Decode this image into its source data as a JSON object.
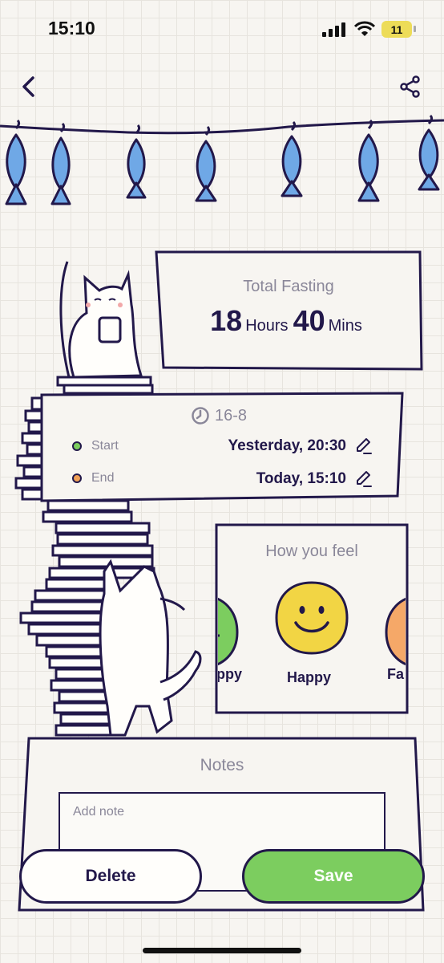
{
  "status_bar": {
    "time": "15:10",
    "battery": "11",
    "icons": [
      "signal-icon",
      "wifi-icon",
      "battery-icon"
    ]
  },
  "header": {
    "back_icon": "chevron-left-icon",
    "share_icon": "share-icon"
  },
  "total_fasting": {
    "label": "Total Fasting",
    "hours": "18",
    "hours_unit": "Hours",
    "minutes": "40",
    "minutes_unit": "Mins"
  },
  "plan": {
    "icon": "clock-icon",
    "name": "16-8",
    "start": {
      "label": "Start",
      "value": "Yesterday, 20:30",
      "dot_color": "#7ccd5f"
    },
    "end": {
      "label": "End",
      "value": "Today, 15:10",
      "dot_color": "#f0a056"
    }
  },
  "feel": {
    "title": "How you feel",
    "moods": [
      {
        "label": "ppy",
        "color": "#7ccd5f"
      },
      {
        "label": "Happy",
        "color": "#f2d544",
        "selected": true
      },
      {
        "label": "Fa",
        "color": "#f5a868"
      }
    ]
  },
  "notes": {
    "title": "Notes",
    "placeholder": "Add note",
    "value": ""
  },
  "actions": {
    "delete_label": "Delete",
    "save_label": "Save"
  },
  "colors": {
    "ink": "#22184a",
    "muted": "#8a8799",
    "accent_green": "#7ccd5f",
    "fish_blue": "#6fa8e6",
    "smiley_yellow": "#f2d544"
  }
}
